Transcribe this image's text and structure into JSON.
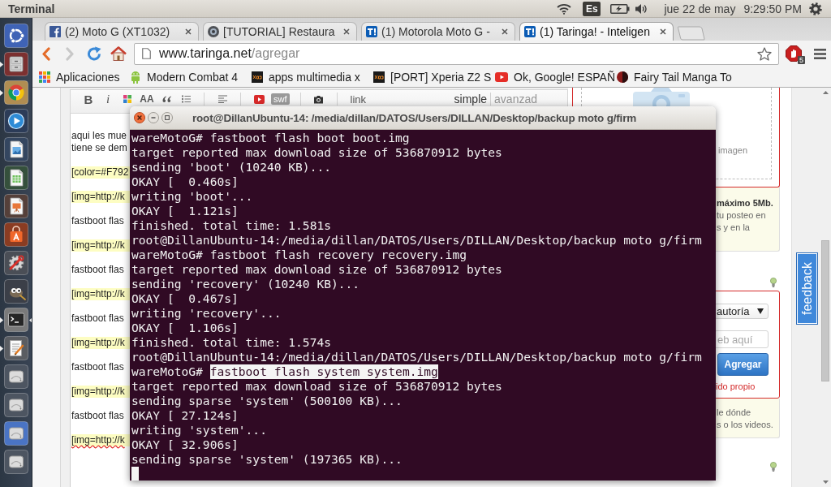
{
  "top_panel": {
    "app_title": "Terminal",
    "keyboard_layout": "Es",
    "date": "jue 22 de may",
    "time": "9:29:50 PM"
  },
  "launcher": {
    "items": [
      {
        "kind": "dash",
        "running": false,
        "focused": false,
        "hovered": false
      },
      {
        "kind": "files",
        "running": true,
        "focused": false,
        "hovered": false
      },
      {
        "kind": "web_browser",
        "running": true,
        "focused": false,
        "hovered": false
      },
      {
        "kind": "media_player",
        "running": false,
        "focused": false,
        "hovered": false
      },
      {
        "kind": "draw",
        "running": false,
        "focused": false,
        "hovered": false
      },
      {
        "kind": "spreadsheet",
        "running": false,
        "focused": false,
        "hovered": false
      },
      {
        "kind": "presentation",
        "running": false,
        "focused": false,
        "hovered": false
      },
      {
        "kind": "software_center",
        "running": false,
        "focused": false,
        "hovered": false
      },
      {
        "kind": "settings",
        "running": false,
        "focused": false,
        "hovered": false
      },
      {
        "kind": "image_editor",
        "running": false,
        "focused": false,
        "hovered": false
      },
      {
        "kind": "terminal",
        "running": true,
        "focused": true,
        "hovered": false
      },
      {
        "kind": "text_editor",
        "running": true,
        "focused": false,
        "hovered": false
      },
      {
        "kind": "drive",
        "running": false,
        "focused": false,
        "hovered": false
      },
      {
        "kind": "drive",
        "running": false,
        "focused": false,
        "hovered": false
      },
      {
        "kind": "drive",
        "running": false,
        "focused": false,
        "hovered": true
      },
      {
        "kind": "drive",
        "running": false,
        "focused": false,
        "hovered": false
      }
    ]
  },
  "browser": {
    "tabs": [
      {
        "kind": "facebook",
        "title": "(2) Moto G (XT1032)",
        "selected": false
      },
      {
        "kind": "globe",
        "title": "[TUTORIAL] Restaura",
        "selected": false
      },
      {
        "kind": "taringa",
        "title": "(1) Motorola Moto G -",
        "selected": false
      },
      {
        "kind": "taringa",
        "title": "(1) Taringa! - Inteligen",
        "selected": true
      }
    ],
    "navigation": {
      "back_disabled": false,
      "forward_disabled": true
    },
    "address": {
      "host": "www.taringa.net",
      "path": "/agregar"
    },
    "extension_badge": "5",
    "bookmarks": [
      {
        "kind": "apps",
        "label": "Aplicaciones"
      },
      {
        "kind": "android",
        "label": "Modern Combat 4"
      },
      {
        "kind": "xda",
        "label": "apps multimedia x"
      },
      {
        "kind": "xda",
        "label": "[PORT] Xperia Z2 S"
      },
      {
        "kind": "youtube",
        "label": "Ok, Google! ESPAÑ"
      },
      {
        "kind": "manga",
        "label": "Fairy Tail Manga To"
      }
    ]
  },
  "page": {
    "editor": {
      "toolbar_groups": [
        [
          {
            "kind": "bold",
            "label": "B"
          },
          {
            "kind": "italic",
            "label": "i"
          },
          {
            "kind": "color"
          },
          {
            "kind": "size",
            "label": "AA"
          },
          {
            "kind": "quote"
          },
          {
            "kind": "list"
          }
        ],
        [
          {
            "kind": "align"
          }
        ],
        [
          {
            "kind": "video"
          },
          {
            "kind": "flash",
            "label": "swf"
          }
        ],
        [
          {
            "kind": "image"
          }
        ],
        [
          {
            "kind": "link",
            "label": "link"
          }
        ]
      ],
      "modes": [
        {
          "label": "simple",
          "selected": true
        },
        {
          "label": "avanzad",
          "selected": false
        }
      ],
      "paragraphs": [
        {
          "lines": [
            "aqui les mue",
            "tiene se dem"
          ],
          "highlighted": false,
          "misspelled": false
        },
        {
          "lines": [
            "[color=#F792"
          ],
          "highlighted": true,
          "misspelled": false
        },
        {
          "lines": [
            "[img=http://k"
          ],
          "highlighted": true,
          "misspelled": false
        },
        {
          "lines": [
            "fastboot flas"
          ],
          "highlighted": false,
          "misspelled": false
        },
        {
          "lines": [
            "[img=http://k"
          ],
          "highlighted": true,
          "misspelled": false
        },
        {
          "lines": [
            "fastboot flas"
          ],
          "highlighted": false,
          "misspelled": false
        },
        {
          "lines": [
            "[img=http://k"
          ],
          "highlighted": true,
          "misspelled": false
        },
        {
          "lines": [
            "fastboot flas"
          ],
          "highlighted": false,
          "misspelled": false
        },
        {
          "lines": [
            "[img=http://k"
          ],
          "highlighted": true,
          "misspelled": false
        },
        {
          "lines": [
            "fastboot flas"
          ],
          "highlighted": false,
          "misspelled": false
        },
        {
          "lines": [
            "[img=http://k"
          ],
          "highlighted": true,
          "misspelled": false
        },
        {
          "lines": [
            "fastboot flas"
          ],
          "highlighted": false,
          "misspelled": false
        },
        {
          "lines": [
            "[img=http://k"
          ],
          "highlighted": true,
          "misspelled": true
        }
      ]
    },
    "sidebar": {
      "upload_box": {
        "label": "imagen"
      },
      "upload_note": {
        "heading": "máximo 5Mb.",
        "lines": [
          "tu posteo en",
          "s y en la"
        ]
      },
      "source_box": {
        "license": "autoría",
        "url_placeholder": "eb aquí",
        "button": "Agregar",
        "note": "ido propio"
      },
      "source_note": {
        "lines": [
          "le dónde",
          "s o los videos."
        ]
      }
    },
    "feedback_tab": "feedback"
  },
  "terminal": {
    "title": "root@DillanUbuntu-14: /media/dillan/DATOS/Users/DILLAN/Desktop/backup moto g/firm",
    "lines": [
      {
        "parts": [
          {
            "text": "wareMotoG# fastboot flash boot boot.img",
            "selected": false
          }
        ]
      },
      {
        "parts": [
          {
            "text": "target reported max download size of 536870912 bytes",
            "selected": false
          }
        ]
      },
      {
        "parts": [
          {
            "text": "sending 'boot' (10240 KB)...",
            "selected": false
          }
        ]
      },
      {
        "parts": [
          {
            "text": "OKAY [  0.460s]",
            "selected": false
          }
        ]
      },
      {
        "parts": [
          {
            "text": "writing 'boot'...",
            "selected": false
          }
        ]
      },
      {
        "parts": [
          {
            "text": "OKAY [  1.121s]",
            "selected": false
          }
        ]
      },
      {
        "parts": [
          {
            "text": "finished. total time: 1.581s",
            "selected": false
          }
        ]
      },
      {
        "parts": [
          {
            "text": "root@DillanUbuntu-14:/media/dillan/DATOS/Users/DILLAN/Desktop/backup moto g/firm",
            "selected": false
          }
        ]
      },
      {
        "parts": [
          {
            "text": "wareMotoG# fastboot flash recovery recovery.img",
            "selected": false
          }
        ]
      },
      {
        "parts": [
          {
            "text": "target reported max download size of 536870912 bytes",
            "selected": false
          }
        ]
      },
      {
        "parts": [
          {
            "text": "sending 'recovery' (10240 KB)...",
            "selected": false
          }
        ]
      },
      {
        "parts": [
          {
            "text": "OKAY [  0.467s]",
            "selected": false
          }
        ]
      },
      {
        "parts": [
          {
            "text": "writing 'recovery'...",
            "selected": false
          }
        ]
      },
      {
        "parts": [
          {
            "text": "OKAY [  1.106s]",
            "selected": false
          }
        ]
      },
      {
        "parts": [
          {
            "text": "finished. total time: 1.574s",
            "selected": false
          }
        ]
      },
      {
        "parts": [
          {
            "text": "root@DillanUbuntu-14:/media/dillan/DATOS/Users/DILLAN/Desktop/backup moto g/firm",
            "selected": false
          }
        ]
      },
      {
        "parts": [
          {
            "text": "wareMotoG# ",
            "selected": false
          },
          {
            "text": "fastboot flash system system.img",
            "selected": true
          }
        ]
      },
      {
        "parts": [
          {
            "text": "target reported max download size of 536870912 bytes",
            "selected": false
          }
        ]
      },
      {
        "parts": [
          {
            "text": "sending sparse 'system' (500100 KB)...",
            "selected": false
          }
        ]
      },
      {
        "parts": [
          {
            "text": "OKAY [ 27.124s]",
            "selected": false
          }
        ]
      },
      {
        "parts": [
          {
            "text": "writing 'system'...",
            "selected": false
          }
        ]
      },
      {
        "parts": [
          {
            "text": "OKAY [ 32.906s]",
            "selected": false
          }
        ]
      },
      {
        "parts": [
          {
            "text": "sending sparse 'system' (197365 KB)...",
            "selected": false
          }
        ]
      }
    ],
    "cursor": true
  }
}
